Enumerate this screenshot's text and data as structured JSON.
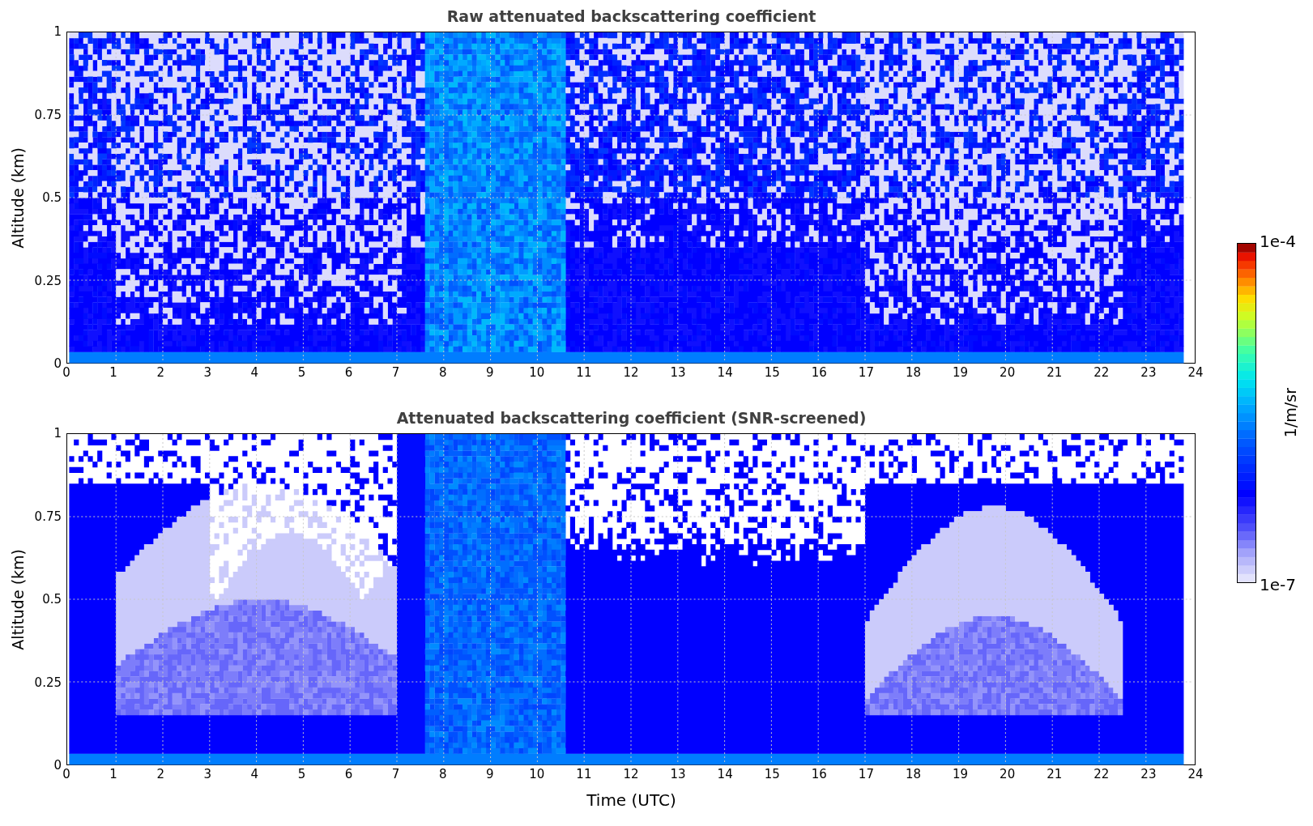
{
  "panels": [
    {
      "kind": "raw",
      "title": "Raw attenuated backscattering coefficient",
      "ylabel": "Altitude (km)",
      "yticks": [
        "1",
        "0.75",
        "0.5",
        "0.25",
        "0"
      ],
      "xticks": [
        "0",
        "1",
        "2",
        "3",
        "4",
        "5",
        "6",
        "7",
        "8",
        "9",
        "10",
        "11",
        "12",
        "13",
        "14",
        "15",
        "16",
        "17",
        "18",
        "19",
        "20",
        "21",
        "22",
        "23",
        "24"
      ]
    },
    {
      "kind": "screened",
      "title": "Attenuated backscattering coefficient (SNR-screened)",
      "ylabel": "Altitude (km)",
      "yticks": [
        "1",
        "0.75",
        "0.5",
        "0.25",
        "0"
      ],
      "xticks": [
        "0",
        "1",
        "2",
        "3",
        "4",
        "5",
        "6",
        "7",
        "8",
        "9",
        "10",
        "11",
        "12",
        "13",
        "14",
        "15",
        "16",
        "17",
        "18",
        "19",
        "20",
        "21",
        "22",
        "23",
        "24"
      ],
      "xlabel": "Time (UTC)"
    }
  ],
  "colorbar": {
    "top_label": "1e-4",
    "bottom_label": "1e-7",
    "unit": "1/m/sr"
  }
}
